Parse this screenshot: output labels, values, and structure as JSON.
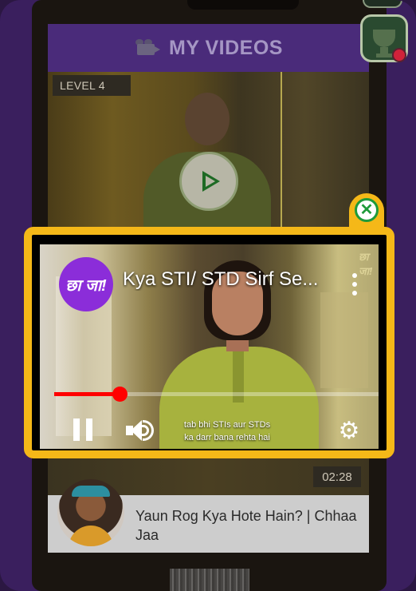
{
  "header": {
    "title": "MY VIDEOS",
    "icon": "video-camera-icon"
  },
  "background_video": {
    "level": "LEVEL 4",
    "partial_duration": "02:2"
  },
  "next_video": {
    "duration": "02:28",
    "title": "Yaun Rog Kya Hote Hain? | Chhaa Jaa",
    "avatar_icon": "character-avatar-icon"
  },
  "player": {
    "channel_logo_text": "छा जा!",
    "watermark": "छा जा!",
    "title": "Kya STI/ STD Sirf Se...",
    "subtitle_line1": "tab bhi STIs aur STDs",
    "subtitle_line2": "ka darr bana rehta hai",
    "progress_fraction": 0.2
  },
  "colors": {
    "accent_yellow": "#f5b818",
    "progress_red": "#ff0000",
    "header_purple": "#4a2b7a",
    "close_green": "#1f9a3a",
    "notification_red": "#d0223a"
  }
}
